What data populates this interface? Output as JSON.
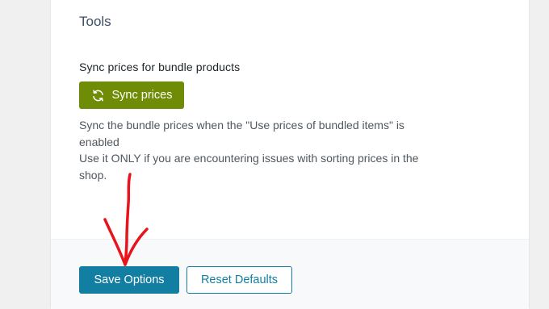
{
  "tools": {
    "title": "Tools",
    "sync_option": {
      "label": "Sync prices for bundle products",
      "button_label": "Sync prices",
      "button_icon": "sync-icon",
      "description_line1": "Sync the bundle prices when the \"Use prices of bundled items\" is enabled",
      "description_line2": "Use it ONLY if you are encountering issues with sorting prices in the shop."
    }
  },
  "footer": {
    "save_label": "Save Options",
    "reset_label": "Reset Defaults"
  },
  "colors": {
    "sync_button": "#6e8c05",
    "primary": "#127fa2",
    "annotation": "#e8141b"
  }
}
